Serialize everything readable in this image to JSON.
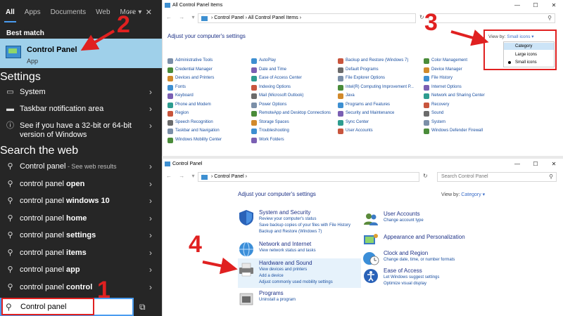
{
  "start": {
    "tabs": [
      "All",
      "Apps",
      "Documents",
      "Web",
      "More"
    ],
    "more_chevron": "▾",
    "best_match_label": "Best match",
    "best": {
      "title": "Control Panel",
      "subtitle": "App"
    },
    "settings_label": "Settings",
    "settings_items": [
      {
        "icon": "laptop-icon",
        "label": "System"
      },
      {
        "icon": "taskbar-icon",
        "label": "Taskbar notification area"
      },
      {
        "icon": "info-icon",
        "label": "See if you have a 32-bit or 64-bit",
        "label2": "version of Windows"
      }
    ],
    "web_label": "Search the web",
    "web_items": [
      {
        "prefix": "Control panel",
        "bold": "",
        "suffix": " - See web results"
      },
      {
        "prefix": "control panel ",
        "bold": "open",
        "suffix": ""
      },
      {
        "prefix": "control panel ",
        "bold": "windows 10",
        "suffix": ""
      },
      {
        "prefix": "control panel ",
        "bold": "home",
        "suffix": ""
      },
      {
        "prefix": "control panel ",
        "bold": "settings",
        "suffix": ""
      },
      {
        "prefix": "control panel ",
        "bold": "items",
        "suffix": ""
      },
      {
        "prefix": "control panel ",
        "bold": "app",
        "suffix": ""
      },
      {
        "prefix": "control panel ",
        "bold": "control",
        "suffix": ""
      }
    ],
    "search_value": "Control panel"
  },
  "win1": {
    "title": "All Control Panel Items",
    "controls": [
      "—",
      "☐",
      "✕"
    ],
    "address": [
      "Control Panel",
      "All Control Panel Items"
    ],
    "search_placeholder": "",
    "heading": "Adjust your computer's settings",
    "viewby_label": "View by:",
    "viewby_value": "Small icons ▾",
    "dropdown": {
      "options": [
        "Category",
        "Large icons",
        "Small icons"
      ],
      "highlighted": "Category",
      "selected": "Small icons"
    },
    "columns": [
      [
        "Administrative Tools",
        "Credential Manager",
        "Devices and Printers",
        "Fonts",
        "Keyboard",
        "Phone and Modem",
        "Region",
        "Speech Recognition",
        "Taskbar and Navigation",
        "Windows Mobility Center"
      ],
      [
        "AutoPlay",
        "Date and Time",
        "Ease of Access Center",
        "Indexing Options",
        "Mail (Microsoft Outlook)",
        "Power Options",
        "RemoteApp and Desktop Connections",
        "Storage Spaces",
        "Troubleshooting",
        "Work Folders"
      ],
      [
        "Backup and Restore (Windows 7)",
        "Default Programs",
        "File Explorer Options",
        "Intel(R) Computing Improvement P...",
        "Java",
        "Programs and Features",
        "Security and Maintenance",
        "Sync Center",
        "User Accounts"
      ],
      [
        "Color Management",
        "Device Manager",
        "File History",
        "Internet Options",
        "Network and Sharing Center",
        "Recovery",
        "Sound",
        "System",
        "Windows Defender Firewall"
      ]
    ],
    "icon_colors": [
      "#7b8fa8",
      "#4a8c3a",
      "#d18a2b",
      "#3d8fd1",
      "#7a5fb3",
      "#2d9c8f",
      "#c8553d",
      "#6b6b6b"
    ]
  },
  "win2": {
    "title": "Control Panel",
    "controls": [
      "—",
      "☐",
      "✕"
    ],
    "address": [
      "Control Panel"
    ],
    "search_placeholder": "Search Control Panel",
    "heading": "Adjust your computer's settings",
    "viewby_label": "View by:",
    "viewby_value": "Category ▾",
    "categories_left": [
      {
        "title": "System and Security",
        "links": [
          "Review your computer's status",
          "Save backup copies of your files with File History",
          "Backup and Restore (Windows 7)"
        ]
      },
      {
        "title": "Network and Internet",
        "links": [
          "View network status and tasks"
        ]
      },
      {
        "title": "Hardware and Sound",
        "links": [
          "View devices and printers",
          "Add a device",
          "Adjust commonly used mobility settings"
        ]
      },
      {
        "title": "Programs",
        "links": [
          "Uninstall a program"
        ]
      }
    ],
    "categories_right": [
      {
        "title": "User Accounts",
        "links": [
          "Change account type"
        ]
      },
      {
        "title": "Appearance and Personalization",
        "links": []
      },
      {
        "title": "Clock and Region",
        "links": [
          "Change date, time, or number formats"
        ]
      },
      {
        "title": "Ease of Access",
        "links": [
          "Let Windows suggest settings",
          "Optimize visual display"
        ]
      }
    ]
  },
  "annotations": {
    "steps": [
      "1",
      "2",
      "3",
      "4"
    ],
    "color": "#e02020"
  }
}
